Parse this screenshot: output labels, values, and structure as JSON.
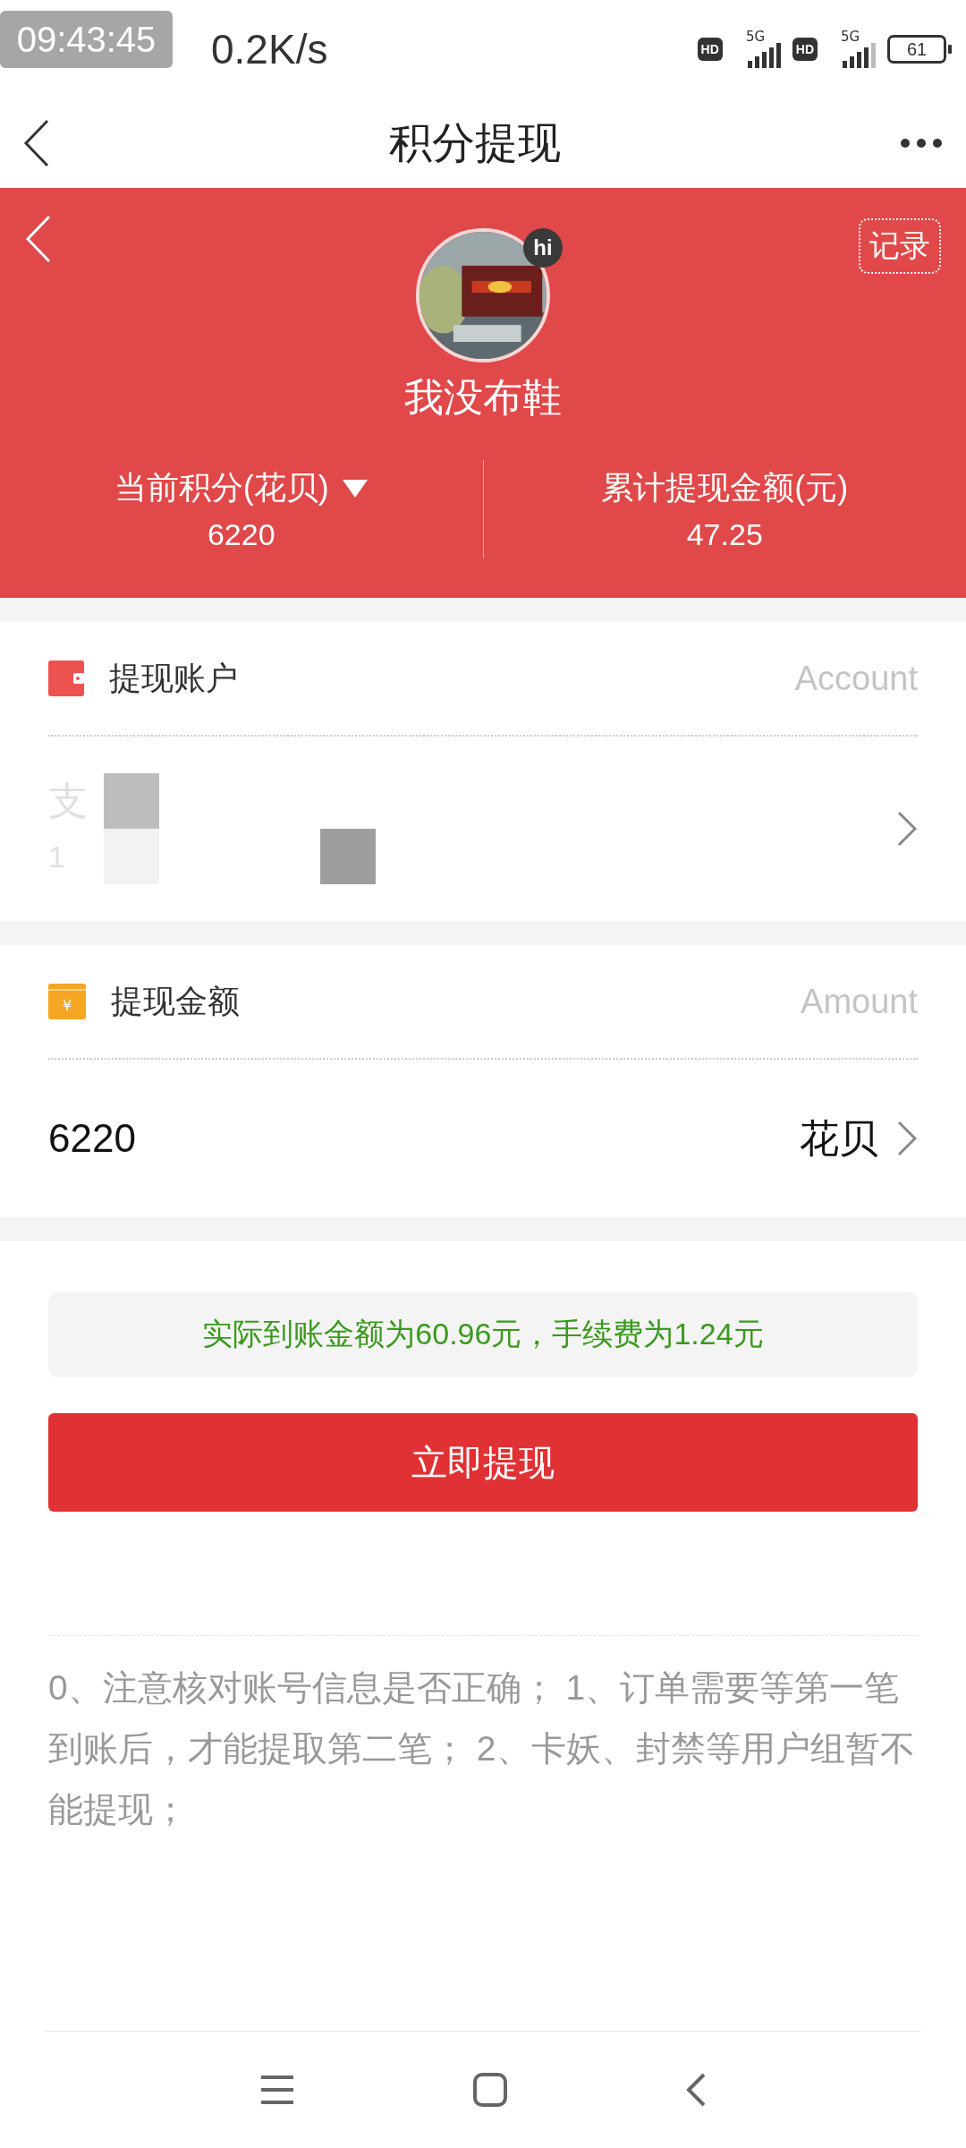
{
  "status_bar": {
    "clock_overlay": "09:43:45",
    "net_speed": "0.2K/s",
    "battery": "61",
    "sims": [
      {
        "hd": "HD",
        "network": "5G"
      },
      {
        "hd": "HD",
        "network": "5G"
      }
    ]
  },
  "nav": {
    "title": "积分提现"
  },
  "profile": {
    "name": "我没布鞋",
    "badge": "hi",
    "records_button": "记录",
    "stats": [
      {
        "label": "当前积分(花贝)",
        "value": "6220",
        "dropdown": true
      },
      {
        "label": "累计提现金额(元)",
        "value": "47.25",
        "dropdown": false
      }
    ]
  },
  "account": {
    "title": "提现账户",
    "hint": "Account",
    "name": "支",
    "number": "1"
  },
  "amount": {
    "title": "提现金额",
    "hint": "Amount",
    "icon_glyph": "¥",
    "value": "6220",
    "unit": "花贝"
  },
  "summary": "实际到账金额为60.96元，手续费为1.24元",
  "submit_button": "立即提现",
  "notes": "0、注意核对账号信息是否正确； 1、订单需要等第一笔到账后，才能提取第二笔； 2、卡妖、封禁等用户组暂不能提现；"
}
